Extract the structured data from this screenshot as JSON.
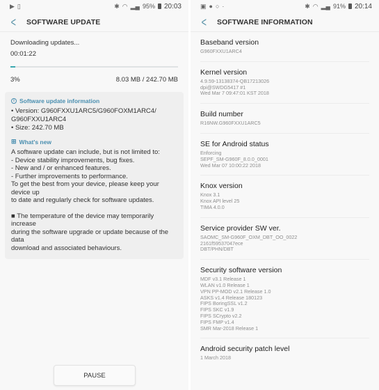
{
  "left": {
    "statusbar": {
      "left_icons": [
        "media-play-icon",
        "clipboard-icon"
      ],
      "battery": "95%",
      "time": "20:03"
    },
    "appbar": {
      "title": "SOFTWARE UPDATE"
    },
    "download": {
      "status": "Downloading updates...",
      "elapsed": "00:01:22",
      "progress_percent": 3,
      "percent_label": "3%",
      "size_label": "8.03 MB / 242.70 MB"
    },
    "info": {
      "heading": "Software update information",
      "version_line1": "• Version: G960FXXU1ARC5/G960FOXM1ARC4/",
      "version_line2": "G960FXXU1ARC4",
      "size_line": "• Size: 242.70 MB"
    },
    "whats_new": {
      "heading": "What's new",
      "lines": [
        "A software update can include, but is not limited to:",
        " - Device stability improvements, bug fixes.",
        " - New and / or enhanced features.",
        " - Further improvements to performance.",
        "To get the best from your device, please keep your device up",
        "to date and regularly check for software updates."
      ],
      "note_lines": [
        "■ The temperature of the device may temporarily increase",
        "during the software upgrade or update because of the data",
        "download and associated behaviours."
      ]
    },
    "pause_label": "PAUSE"
  },
  "right": {
    "statusbar": {
      "left_icons": [
        "gallery-icon",
        "messenger-icon",
        "whatsapp-icon",
        "dot-icon"
      ],
      "battery": "91%",
      "time": "20:14"
    },
    "appbar": {
      "title": "SOFTWARE INFORMATION"
    },
    "items": [
      {
        "title": "Baseband version",
        "values": [
          "G960FXXU1ARC4"
        ]
      },
      {
        "title": "Kernel version",
        "values": [
          "4.9.59-13138374-QB17213026",
          "dpi@SWDG5417 #1",
          "Wed Mar 7 09:47:01 KST 2018"
        ]
      },
      {
        "title": "Build number",
        "values": [
          "R16NW.G960FXXU1ARC5"
        ]
      },
      {
        "title": "SE for Android status",
        "values": [
          "Enforcing",
          "SEPF_SM-G960F_8.0.0_0001",
          "Wed Mar 07 10:00:22 2018"
        ]
      },
      {
        "title": "Knox version",
        "values": [
          "Knox 3.1",
          "Knox API level 25",
          "TIMA 4.0.0"
        ]
      },
      {
        "title": "Service provider SW ver.",
        "values": [
          "SAOMC_SM-G960F_OXM_DBT_OO_0022",
          "2161f59537047ece",
          "DBT/PHN/DBT"
        ]
      },
      {
        "title": "Security software version",
        "values": [
          "MDF v3.1 Release 1",
          "WLAN v1.0 Release 1",
          "VPN PP-MOD v2.1 Release 1.0",
          "ASKS v1.4 Release 180123",
          "FIPS BoringSSL v1.2",
          "FIPS SKC v1.9",
          "FIPS SCrypto v2.2",
          "FIPS FMP v1.4",
          "SMR Mar-2018 Release 1"
        ]
      },
      {
        "title": "Android security patch level",
        "values": [
          "1 March 2018"
        ]
      }
    ]
  },
  "colors": {
    "accent": "#3ba7b0",
    "info_heading": "#4a8fb0",
    "back_arrow": "#5a93a8"
  }
}
